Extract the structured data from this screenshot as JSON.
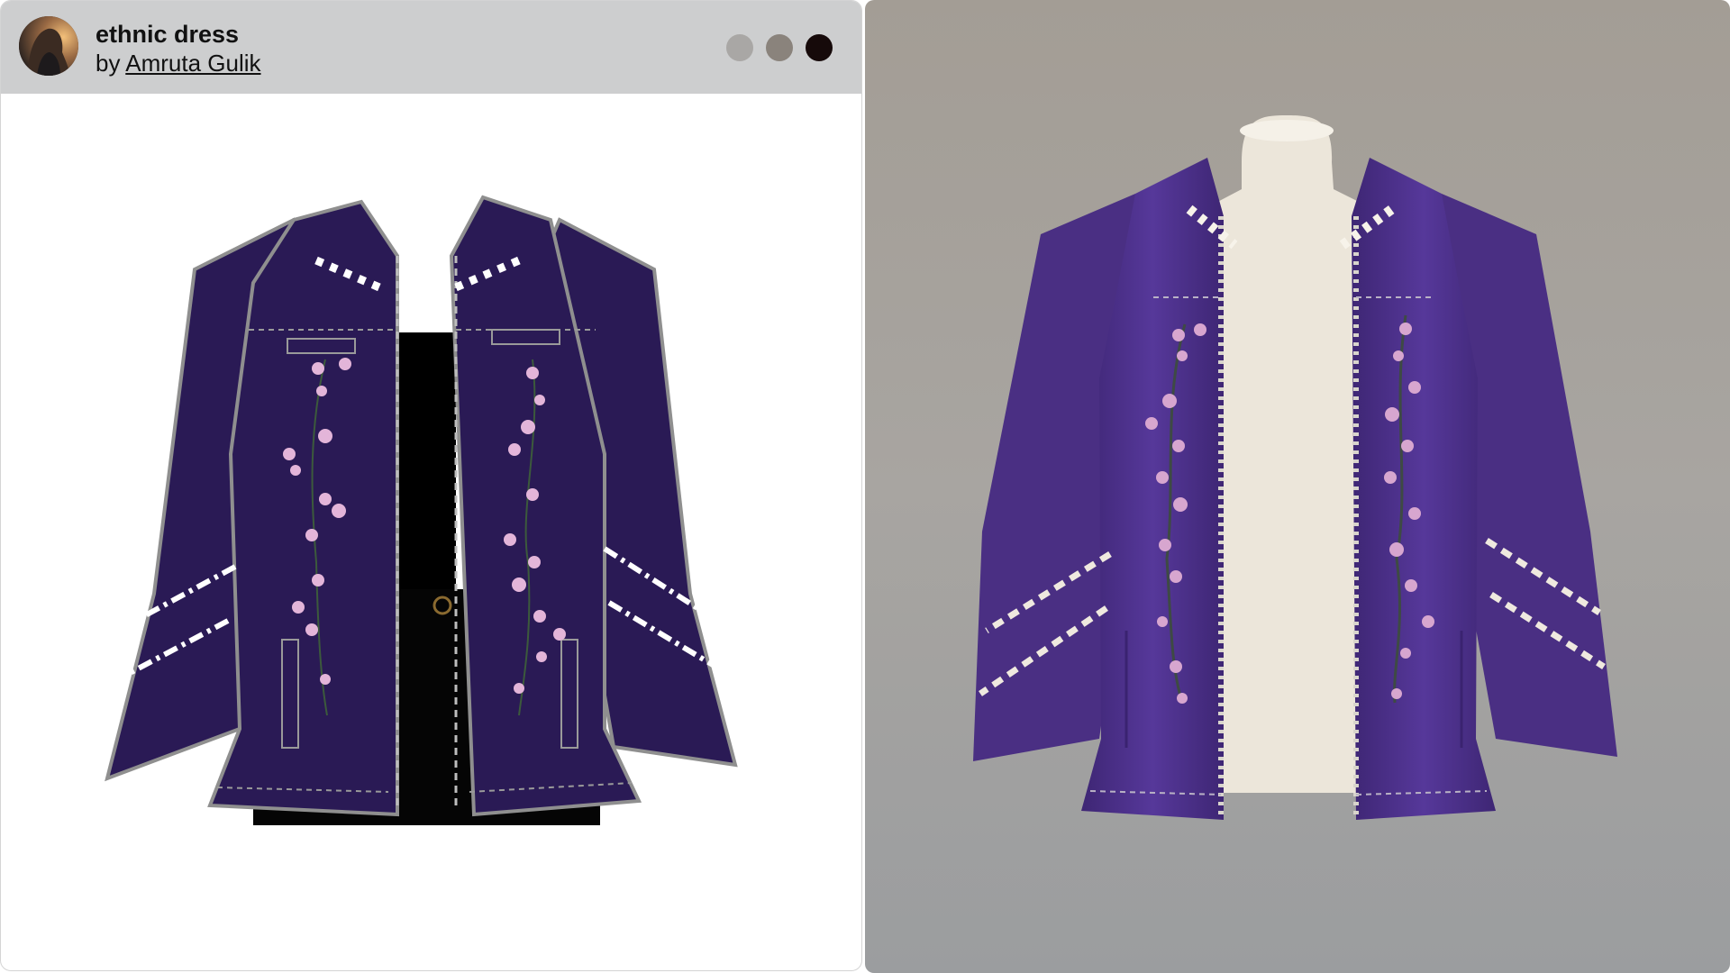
{
  "card": {
    "title": "ethnic dress",
    "by_label": "by",
    "author": "Amruta Gulik"
  },
  "swatches": [
    {
      "name": "light-gray",
      "color": "#a9a7a5"
    },
    {
      "name": "warm-gray",
      "color": "#8a837c"
    },
    {
      "name": "dark-brown",
      "color": "#160a0a"
    }
  ],
  "colors": {
    "header_bg": "#cdcecf",
    "jacket_purple": "#2a1a55",
    "photo_jacket_purple": "#4e3289",
    "embroidery_pink": "#e3b5d9",
    "photo_bg": "#9e9a94"
  }
}
